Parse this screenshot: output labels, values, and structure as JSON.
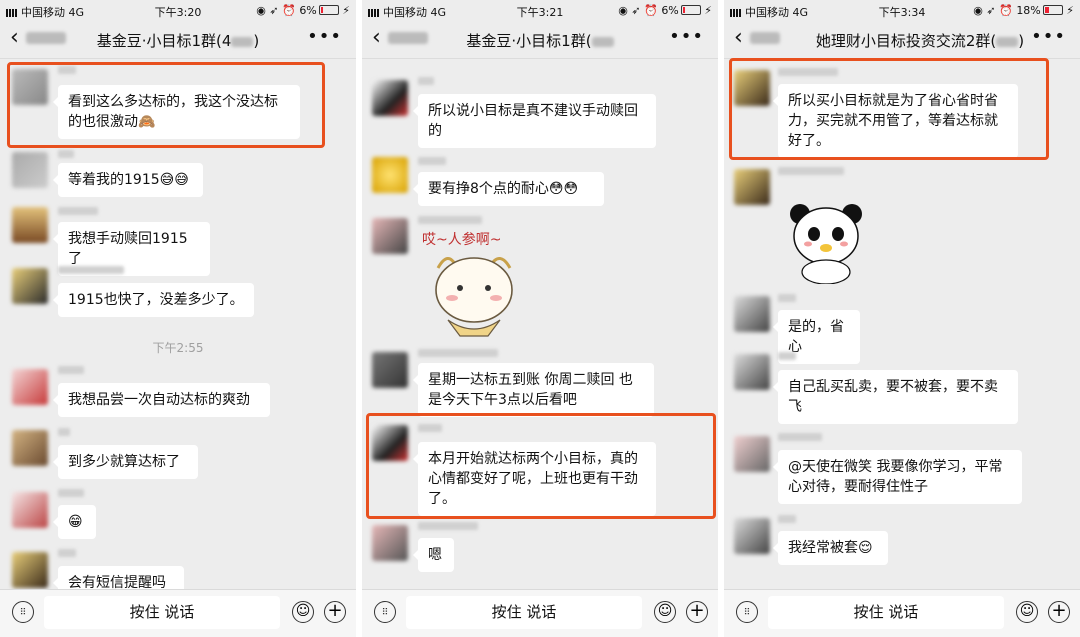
{
  "statusbars": [
    {
      "carrier": "中国移动",
      "network": "4G",
      "time": "下午3:20",
      "battery": "6%"
    },
    {
      "carrier": "中国移动",
      "network": "4G",
      "time": "下午3:21",
      "battery": "6%"
    },
    {
      "carrier": "中国移动",
      "network": "4G",
      "time": "下午3:34",
      "battery": "18%"
    }
  ],
  "titles": [
    "基金豆·小目标1群(4",
    "基金豆·小目标1群(",
    "她理财小目标投资交流2群("
  ],
  "panel1": {
    "messages": [
      "看到这么多达标的，我这个没达标的也很激动🙈",
      "等着我的1915😅😅",
      "我想手动赎回1915了",
      "1915也快了，没差多少了。",
      "我想品尝一次自动达标的爽劲",
      "到多少就算达标了",
      "😁",
      "会有短信提醒吗"
    ],
    "time_divider": "下午2:55"
  },
  "panel2": {
    "messages": [
      "所以说小目标是真不建议手动赎回的",
      "要有挣8个点的耐心😳😳",
      "星期一达标五到账 你周二赎回 也是今天下午3点以后看吧",
      "本月开始就达标两个小目标，真的心情都变好了呢，上班也更有干劲了。",
      "嗯"
    ],
    "sticker_text": "哎~人参啊~"
  },
  "panel3": {
    "messages": [
      "所以买小目标就是为了省心省时省力，买完就不用管了，等着达标就好了。",
      "是的，省心",
      "自己乱买乱卖，要不被套，要不卖飞",
      "@天使在微笑 我要像你学习，平常心对待，要耐得住性子",
      "我经常被套😌"
    ]
  },
  "input_bar": {
    "hold_to_talk": "按住 说话"
  },
  "colors": {
    "highlight": "#e8501e",
    "chat_bg": "#ededed",
    "bubble": "#ffffff"
  }
}
